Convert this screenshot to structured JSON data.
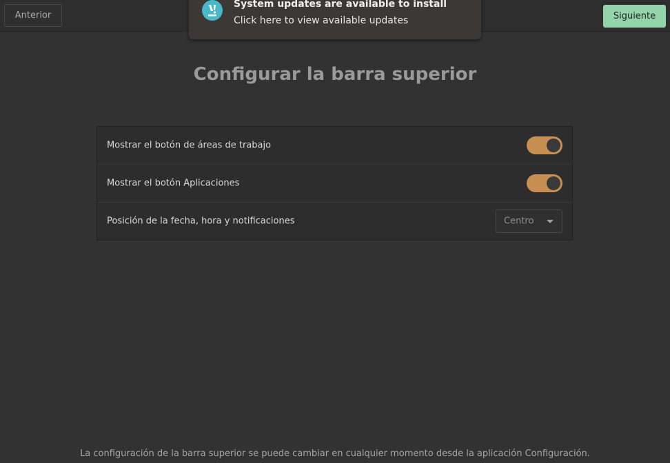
{
  "header": {
    "prev_label": "Anterior",
    "next_label": "Siguiente"
  },
  "notification": {
    "icon": "pop-os-logo-icon",
    "title": "System updates are available to install",
    "body": "Click here to view available updates"
  },
  "page": {
    "title": "Configurar la barra superior"
  },
  "settings": [
    {
      "label": "Mostrar el botón de áreas de trabajo",
      "control": "switch",
      "value": true
    },
    {
      "label": "Mostrar el botón Aplicaciones",
      "control": "switch",
      "value": true
    },
    {
      "label": "Posición de la fecha, hora y notificaciones",
      "control": "dropdown",
      "value": "Centro"
    }
  ],
  "footer": {
    "text": "La configuración de la barra superior se puede cambiar en cualquier momento desde la aplicación Configuración."
  },
  "colors": {
    "accent_switch": "#c78f52",
    "next_button": "#94d4ab",
    "notification_icon": "#48b9c7",
    "background": "#323232"
  }
}
